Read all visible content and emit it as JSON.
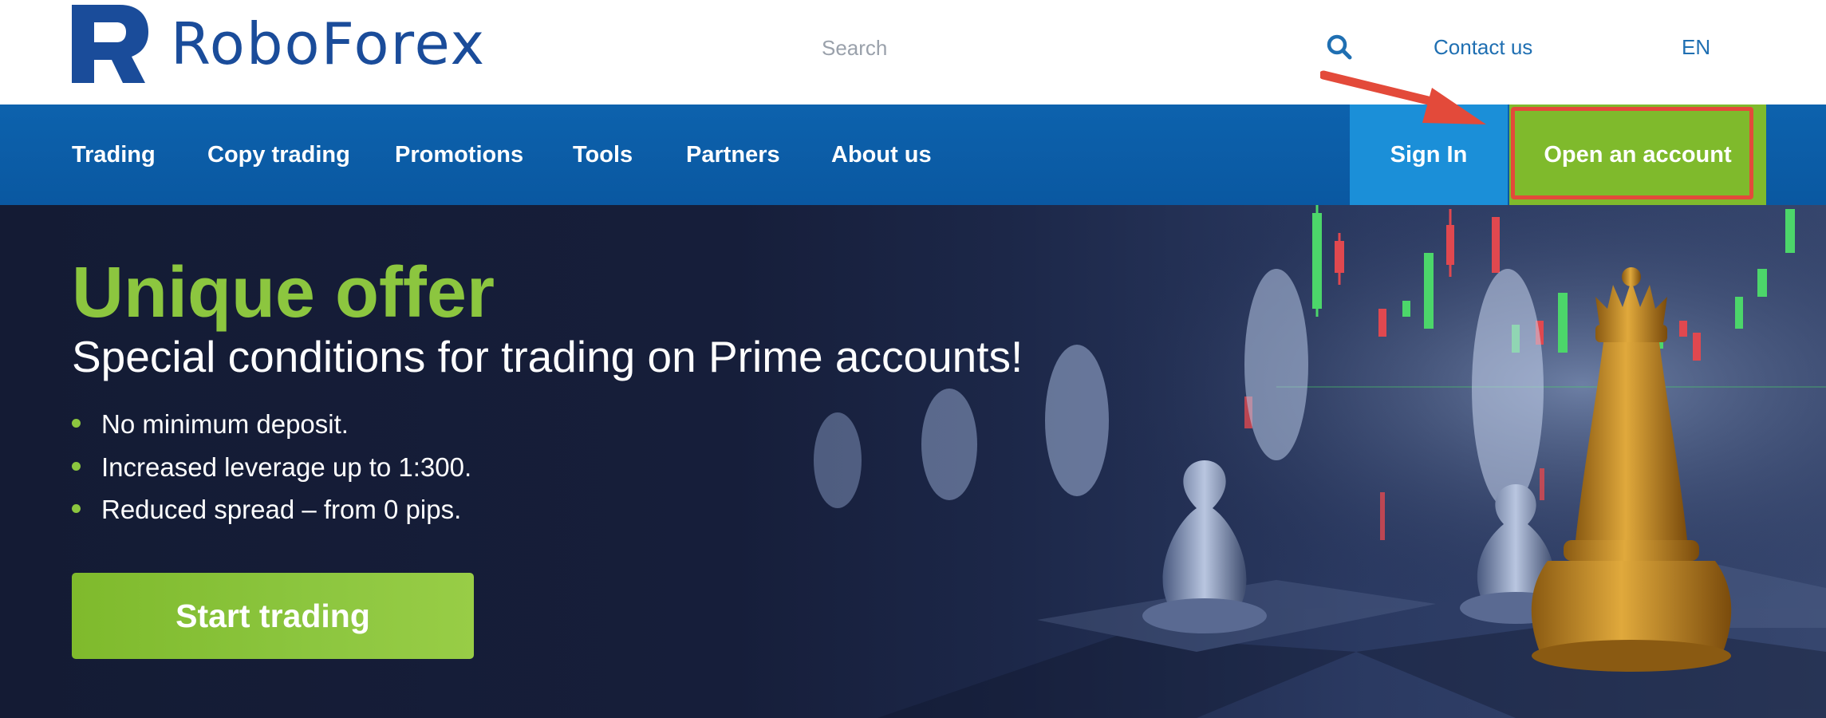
{
  "header": {
    "brand": "RoboForex",
    "search": {
      "placeholder": "Search",
      "value": ""
    },
    "contact_label": "Contact us",
    "language": "EN"
  },
  "nav": {
    "items": [
      {
        "label": "Trading"
      },
      {
        "label": "Copy trading"
      },
      {
        "label": "Promotions"
      },
      {
        "label": "Tools"
      },
      {
        "label": "Partners"
      },
      {
        "label": "About us"
      }
    ],
    "signin_label": "Sign In",
    "open_account_label": "Open an account"
  },
  "hero": {
    "title": "Unique offer",
    "subtitle": "Special conditions for trading on Prime accounts!",
    "benefits": [
      "No minimum deposit.",
      "Increased leverage up to 1:300.",
      "Reduced spread – from 0 pips."
    ],
    "cta_label": "Start trading"
  },
  "icons": {
    "logo": "roboforex-logo-icon",
    "search": "search-icon",
    "bullet": "bullet-dot-icon",
    "annotation": "red-arrow-icon"
  },
  "colors": {
    "brand_blue": "#1a4c9a",
    "nav_blue": "#0d62ad",
    "signin_blue": "#1b8fd8",
    "accent_green": "#8cc63f",
    "button_green": "#7fba2c",
    "hero_background": "#161e3a",
    "annotation_red": "#e34a3a"
  }
}
